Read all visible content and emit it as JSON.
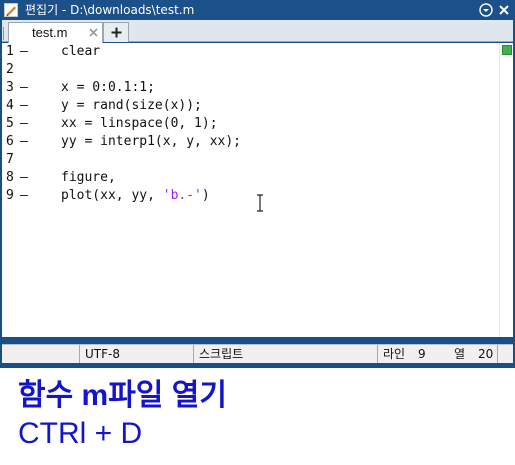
{
  "window": {
    "title": "편집기 - D:\\downloads\\test.m",
    "icons": {
      "app": "edit-pencil-icon",
      "menu": "chevron-down-circle-icon",
      "close": "close-icon"
    }
  },
  "tabs": [
    {
      "label": "test.m",
      "close_icon": "close-icon"
    }
  ],
  "add_tab_icon": "plus-icon",
  "editor": {
    "lines": [
      {
        "num": "1",
        "mark": "–",
        "code": "clear"
      },
      {
        "num": "2",
        "mark": "",
        "code": ""
      },
      {
        "num": "3",
        "mark": "–",
        "code": "x = 0:0.1:1;"
      },
      {
        "num": "4",
        "mark": "–",
        "code": "y = rand(size(x));"
      },
      {
        "num": "5",
        "mark": "–",
        "code": "xx = linspace(0, 1);"
      },
      {
        "num": "6",
        "mark": "–",
        "code": "yy = interp1(x, y, xx);"
      },
      {
        "num": "7",
        "mark": "",
        "code": ""
      },
      {
        "num": "8",
        "mark": "–",
        "code": "figure,"
      },
      {
        "num": "9",
        "mark": "–",
        "code_prefix": "plot(xx, yy, ",
        "code_string": "'b.-'",
        "code_suffix": ")"
      }
    ],
    "code_analyzer_status_color": "#43b04b",
    "string_color": "#a020f0"
  },
  "statusbar": {
    "encoding": "UTF-8",
    "file_type": "스크립트",
    "line_label": "라인",
    "line_value": "9",
    "col_label": "열",
    "col_value": "20"
  },
  "caption": {
    "line1": "함수 m파일 열기",
    "line2": "CTRl + D",
    "color": "#1414c8"
  }
}
